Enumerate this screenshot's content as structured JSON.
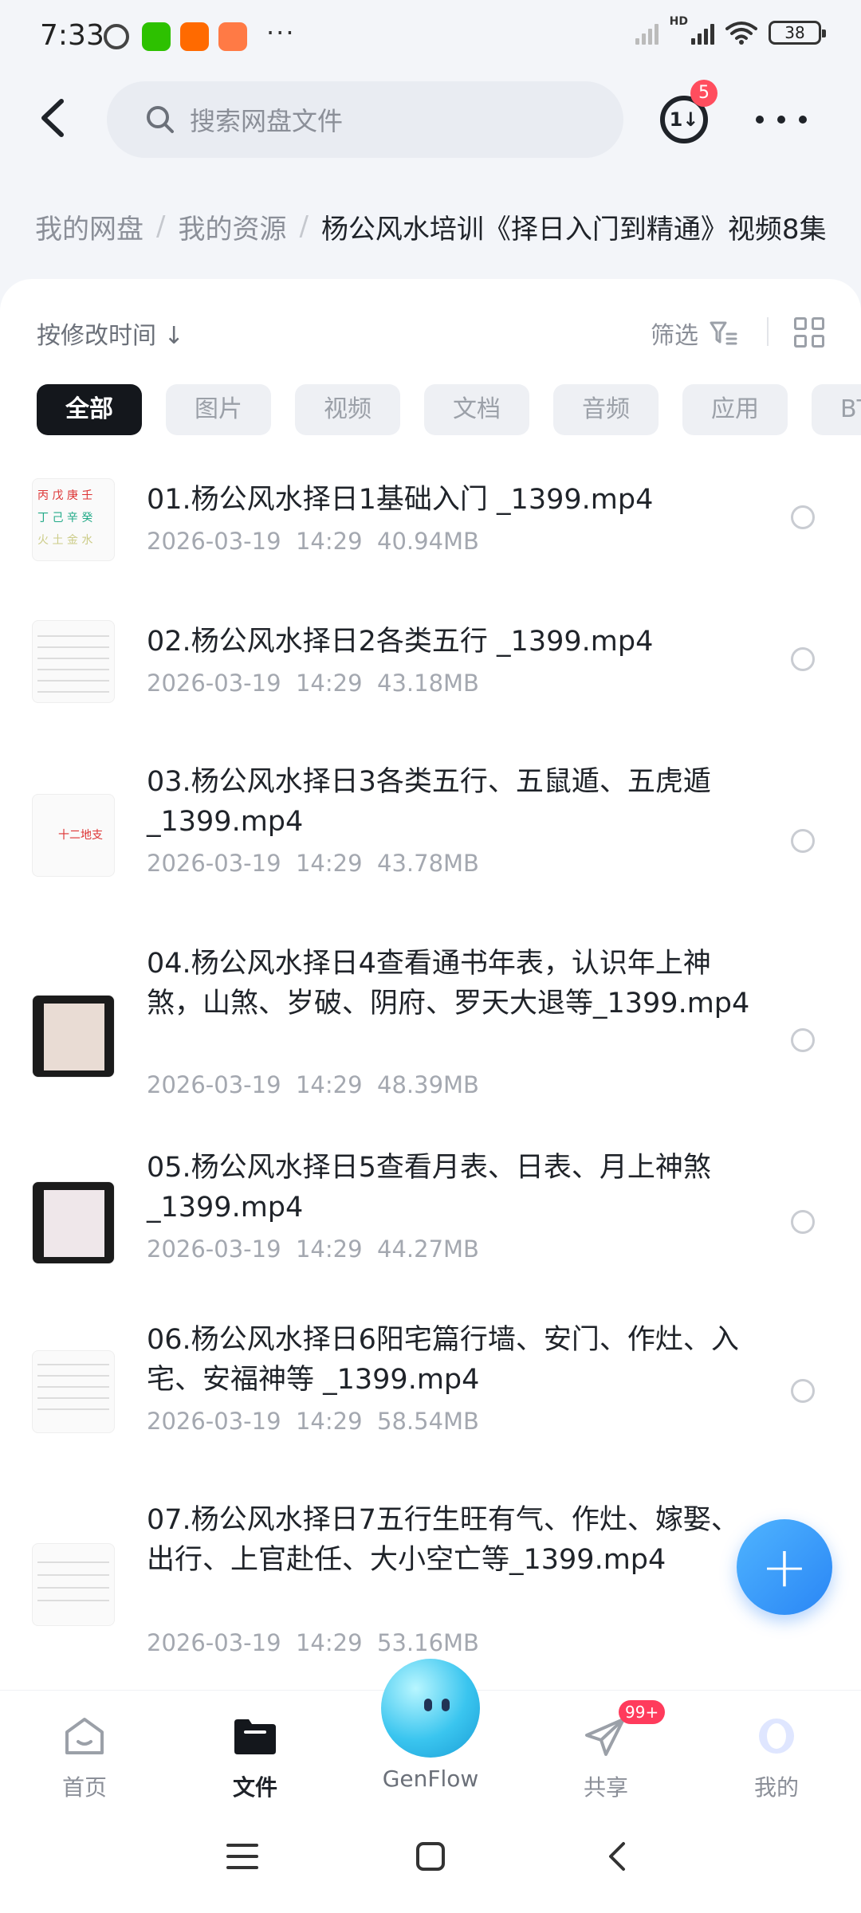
{
  "status_bar": {
    "time": "7:33",
    "more": "···",
    "hd_label": "HD",
    "battery": "38"
  },
  "header": {
    "search_placeholder": "搜索网盘文件",
    "transfer_icon_label": "1↓",
    "transfer_badge": "5"
  },
  "breadcrumb": {
    "items": [
      "我的网盘",
      "我的资源"
    ],
    "separator": "/",
    "current": "杨公风水培训《择日入门到精通》视频8集"
  },
  "toolbar": {
    "sort_label": "按修改时间 ↓",
    "filter_label": "筛选"
  },
  "chips": [
    "全部",
    "图片",
    "视频",
    "文档",
    "音频",
    "应用",
    "BT种子"
  ],
  "files": [
    {
      "name": "01.杨公风水择日1基础入门 _1399.mp4",
      "date": "2026-03-19",
      "time": "14:29",
      "size": "40.94MB"
    },
    {
      "name": "02.杨公风水择日2各类五行 _1399.mp4",
      "date": "2026-03-19",
      "time": "14:29",
      "size": "43.18MB"
    },
    {
      "name": "03.杨公风水择日3各类五行、五鼠遁、五虎遁_1399.mp4",
      "date": "2026-03-19",
      "time": "14:29",
      "size": "43.78MB"
    },
    {
      "name": "04.杨公风水择日4查看通书年表，认识年上神煞，山煞、岁破、阴府、罗天大退等_1399.mp4",
      "date": "2026-03-19",
      "time": "14:29",
      "size": "48.39MB"
    },
    {
      "name": "05.杨公风水择日5查看月表、日表、月上神煞_1399.mp4",
      "date": "2026-03-19",
      "time": "14:29",
      "size": "44.27MB"
    },
    {
      "name": "06.杨公风水择日6阳宅篇行墙、安门、作灶、入宅、安福神等 _1399.mp4",
      "date": "2026-03-19",
      "time": "14:29",
      "size": "58.54MB"
    },
    {
      "name": "07.杨公风水择日7五行生旺有气、作灶、嫁娶、出行、上官赴任、大小空亡等_1399.mp4",
      "date": "2026-03-19",
      "time": "14:29",
      "size": "53.16MB"
    }
  ],
  "fab_label": "+",
  "bottom_nav": {
    "home": "首页",
    "files": "文件",
    "genflow": "GenFlow",
    "share": "共享",
    "share_badge": "99+",
    "me": "我的"
  },
  "colors": {
    "accent": "#2a86f5",
    "badge": "#ff4d5e",
    "chip_active": "#14171c"
  }
}
